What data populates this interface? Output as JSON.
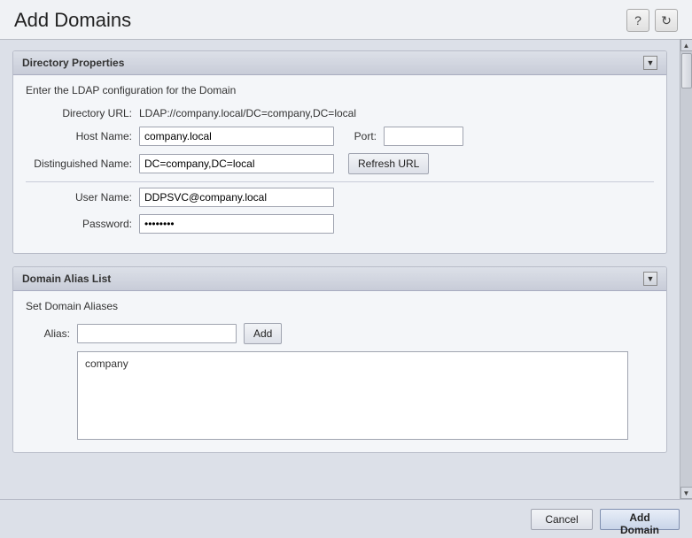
{
  "header": {
    "title": "Add Domains",
    "help_icon": "?",
    "refresh_icon": "↻"
  },
  "directory_panel": {
    "title": "Directory Properties",
    "subtitle": "Enter the LDAP configuration for the Domain",
    "fields": {
      "directory_url_label": "Directory URL:",
      "directory_url_value": "LDAP://company.local/DC=company,DC=local",
      "hostname_label": "Host Name:",
      "hostname_value": "company.local",
      "port_label": "Port:",
      "port_value": "",
      "distinguished_name_label": "Distinguished Name:",
      "distinguished_name_value": "DC=company,DC=local",
      "refresh_url_label": "Refresh URL",
      "username_label": "User Name:",
      "username_value": "DDPSVC@company.local",
      "password_label": "Password:",
      "password_value": "••••••••"
    }
  },
  "alias_panel": {
    "title": "Domain Alias List",
    "subtitle": "Set Domain Aliases",
    "alias_label": "Alias:",
    "alias_placeholder": "",
    "add_button_label": "Add",
    "alias_list_items": [
      "company"
    ]
  },
  "footer": {
    "cancel_label": "Cancel",
    "add_domain_label": "Add Domain"
  }
}
